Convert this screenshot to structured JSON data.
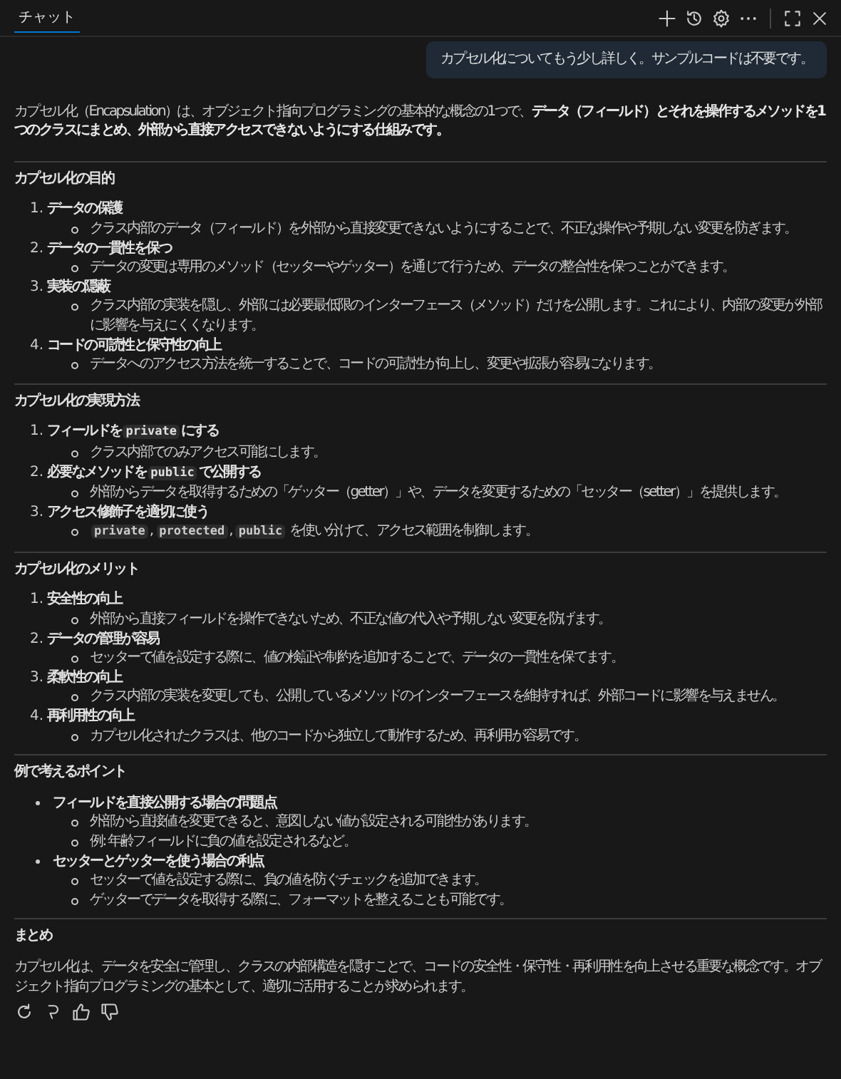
{
  "panel": {
    "tabs": [
      {
        "label": "チャット",
        "selected": true
      }
    ]
  },
  "user_message": "カプセル化についてもう少し詳しく。サンプルコードは不要です。",
  "response": {
    "intro": "カプセル化（Encapsulation）は、オブジェクト指向プログラミングの基本的な概念の1つで、**データ（フィールド）とそれを操作するメソッドを1つのクラスにまとめ、外部から直接アクセスできないようにする仕組みです。**",
    "sections": [
      {
        "heading": "カプセル化の目的",
        "items": [
          {
            "marker": "1.",
            "title": [
              {
                "kind": "text",
                "text": "データの保護"
              }
            ],
            "details": [
              [
                {
                  "kind": "text",
                  "text": "クラス内部のデータ（フィールド）を外部から直接変更できないようにすることで、不正な操作や予期しない変更を防ぎます。"
                }
              ]
            ]
          },
          {
            "marker": "2.",
            "title": [
              {
                "kind": "text",
                "text": "データの一貫性を保つ"
              }
            ],
            "details": [
              [
                {
                  "kind": "text",
                  "text": "データの変更は専用のメソッド（セッターやゲッター）を通じて行うため、データの整合性を保つことができます。"
                }
              ]
            ]
          },
          {
            "marker": "3.",
            "title": [
              {
                "kind": "text",
                "text": "実装の隠蔽"
              }
            ],
            "details": [
              [
                {
                  "kind": "text",
                  "text": "クラス内部の実装を隠し、外部には必要最低限のインターフェース（メソッド）だけを公開します。これにより、内部の変更が外部に影響を与えにくくなります。"
                }
              ]
            ]
          },
          {
            "marker": "4.",
            "title": [
              {
                "kind": "text",
                "text": "コードの可読性と保守性の向上"
              }
            ],
            "details": [
              [
                {
                  "kind": "text",
                  "text": "データへのアクセス方法を統一することで、コードの可読性が向上し、変更や拡張が容易になります。"
                }
              ]
            ]
          }
        ]
      },
      {
        "heading": "カプセル化の実現方法",
        "items": [
          {
            "marker": "1.",
            "title": [
              {
                "kind": "text",
                "text": "フィールドを"
              },
              {
                "kind": "code",
                "text": "private"
              },
              {
                "kind": "text",
                "text": "にする"
              }
            ],
            "details": [
              [
                {
                  "kind": "text",
                  "text": "クラス内部でのみアクセス可能にします。"
                }
              ]
            ]
          },
          {
            "marker": "2.",
            "title": [
              {
                "kind": "text",
                "text": "必要なメソッドを"
              },
              {
                "kind": "code",
                "text": "public"
              },
              {
                "kind": "text",
                "text": "で公開する"
              }
            ],
            "details": [
              [
                {
                  "kind": "text",
                  "text": "外部からデータを取得するための「ゲッター（getter）」や、データを変更するための「セッター（setter）」を提供します。"
                }
              ]
            ]
          },
          {
            "marker": "3.",
            "title": [
              {
                "kind": "text",
                "text": "アクセス修飾子を適切に使う"
              }
            ],
            "details": [
              [
                {
                  "kind": "code",
                  "text": "private"
                },
                {
                  "kind": "text",
                  "text": ", "
                },
                {
                  "kind": "code",
                  "text": "protected"
                },
                {
                  "kind": "text",
                  "text": ", "
                },
                {
                  "kind": "code",
                  "text": "public"
                },
                {
                  "kind": "text",
                  "text": " を使い分けて、アクセス範囲を制御します。"
                }
              ]
            ]
          }
        ]
      },
      {
        "heading": "カプセル化のメリット",
        "items": [
          {
            "marker": "1.",
            "title": [
              {
                "kind": "text",
                "text": "安全性の向上"
              }
            ],
            "details": [
              [
                {
                  "kind": "text",
                  "text": "外部から直接フィールドを操作できないため、不正な値の代入や予期しない変更を防げます。"
                }
              ]
            ]
          },
          {
            "marker": "2.",
            "title": [
              {
                "kind": "text",
                "text": "データの管理が容易"
              }
            ],
            "details": [
              [
                {
                  "kind": "text",
                  "text": "セッターで値を設定する際に、値の検証や制約を追加することで、データの一貫性を保てます。"
                }
              ]
            ]
          },
          {
            "marker": "3.",
            "title": [
              {
                "kind": "text",
                "text": "柔軟性の向上"
              }
            ],
            "details": [
              [
                {
                  "kind": "text",
                  "text": "クラス内部の実装を変更しても、公開しているメソッドのインターフェースを維持すれば、外部コードに影響を与えません。"
                }
              ]
            ]
          },
          {
            "marker": "4.",
            "title": [
              {
                "kind": "text",
                "text": "再利用性の向上"
              }
            ],
            "details": [
              [
                {
                  "kind": "text",
                  "text": "カプセル化されたクラスは、他のコードから独立して動作するため、再利用が容易です。"
                }
              ]
            ]
          }
        ]
      },
      {
        "heading": "例で考えるポイント",
        "items": [
          {
            "title": [
              {
                "kind": "text",
                "text": "フィールドを直接公開する場合の問題点"
              }
            ],
            "details": [
              [
                {
                  "kind": "text",
                  "text": "外部から直接値を変更できると、意図しない値が設定される可能性があります。"
                }
              ],
              [
                {
                  "kind": "text",
                  "text": "例: 年齢フィールドに負の値を設定されるなど。"
                }
              ]
            ]
          },
          {
            "title": [
              {
                "kind": "text",
                "text": "セッターとゲッターを使う場合の利点"
              }
            ],
            "details": [
              [
                {
                  "kind": "text",
                  "text": "セッターで値を設定する際に、負の値を防ぐチェックを追加できます。"
                }
              ],
              [
                {
                  "kind": "text",
                  "text": "ゲッターでデータを取得する際に、フォーマットを整えることも可能です。"
                }
              ]
            ]
          }
        ]
      }
    ],
    "summary": {
      "heading": "まとめ",
      "text": "カプセル化は、データを安全に管理し、クラスの内部構造を隠すことで、コードの安全性・保守性・再利用性を向上させる重要な概念です。オブジェクト指向プログラミングの基本として、適切に活用することが求められます。"
    }
  }
}
